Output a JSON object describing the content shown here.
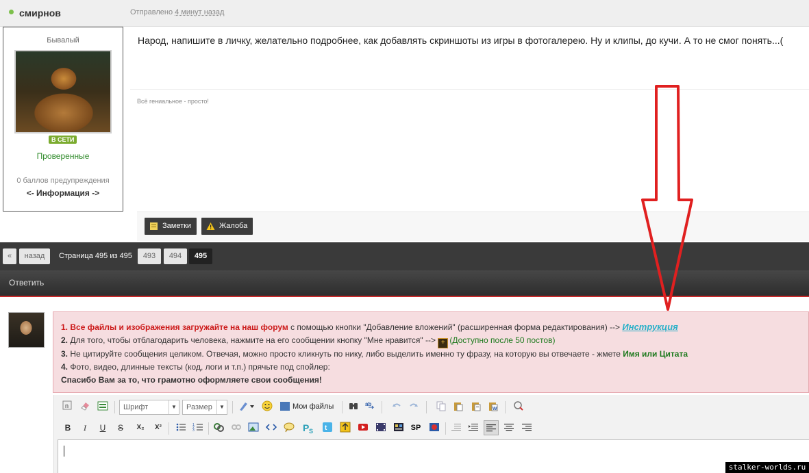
{
  "post": {
    "author": "смирнов",
    "sent_prefix": "Отправлено",
    "sent_ago": "4 минут назад",
    "rank": "Бывалый",
    "online_badge": "В СЕТИ",
    "group": "Проверенные",
    "warnings": "0 баллов предупреждения",
    "info_link": "<- Информация ->",
    "text": "Народ, напишите в личку, желательно подробнее, как добавлять скриншоты из игры в фотогалерею. Ну и клипы, до кучи. А то не смог понять...(",
    "signature": "Всё гениальное - просто!",
    "buttons": {
      "notes": "Заметки",
      "complaint": "Жалоба"
    }
  },
  "pagination": {
    "first": "«",
    "back": "назад",
    "label": "Страница 495 из 495",
    "pages": [
      "493",
      "494",
      "495"
    ],
    "active": "495"
  },
  "reply": {
    "title": "Ответить",
    "rules": {
      "r1_num": "1.",
      "r1_bold": "Все файлы и изображения загружайте на наш форум",
      "r1_text": " с помощью кнопки \"Добавление вложений\" (расширенная форма редактирования) --> ",
      "r1_link": "Инструкция",
      "r2_num": "2.",
      "r2_text": " Для того, чтобы отблагодарить человека, нажмите на его сообщении кнопку \"Мне нравится\" --> ",
      "r2_green": "(Доступно после 50 постов)",
      "r3_num": "3.",
      "r3_text": " Не цитируйте сообщения целиком. Отвечая, можно просто кликнуть по нику, либо выделить именно ту фразу, на которую вы отвечаете - жмете ",
      "r3_green": "Имя или Цитата",
      "r4_num": "4.",
      "r4_text": " Фото, видео, длинные тексты (код, логи и т.п.) прячьте под спойлер:",
      "thanks": "Спасибо Вам за то, что грамотно оформляете свои сообщения!"
    },
    "editor": {
      "font_placeholder": "Шрифт",
      "size_placeholder": "Размер",
      "my_files": "Мои файлы",
      "sp_label": "SP",
      "bold": "B",
      "italic": "I",
      "underline": "U",
      "strike": "S",
      "sub": "X₂",
      "sup": "X²"
    }
  },
  "colors": {
    "accent_red": "#cc1a1a",
    "online_green": "#7bab2f",
    "link_cyan": "#2ab0c8",
    "arrow_red": "#e02020"
  },
  "watermark": "stalker-worlds.ru"
}
